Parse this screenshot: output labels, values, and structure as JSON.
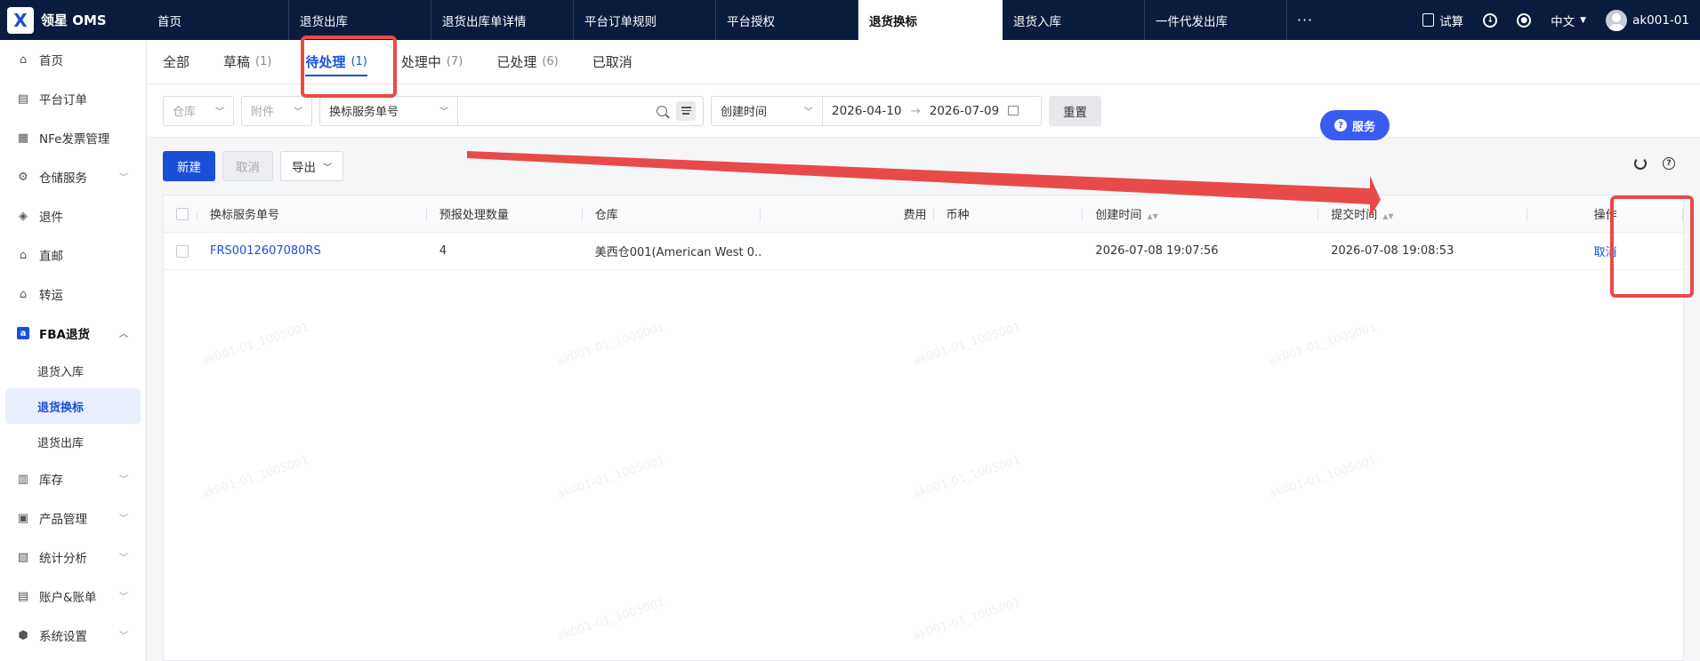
{
  "app": {
    "logo_text": "领星 OMS"
  },
  "topbar": {
    "tabs": [
      {
        "label": "首页"
      },
      {
        "label": "退货出库"
      },
      {
        "label": "退货出库单详情"
      },
      {
        "label": "平台订单规则"
      },
      {
        "label": "平台授权"
      },
      {
        "label": "退货换标",
        "active": true
      },
      {
        "label": "退货入库"
      },
      {
        "label": "一件代发出库"
      }
    ],
    "more": "···",
    "calc_label": "试算",
    "lang_label": "中文",
    "user_label": "ak001-01"
  },
  "sidebar": {
    "items": [
      {
        "label": "首页",
        "icon": "home-icon"
      },
      {
        "label": "平台订单",
        "icon": "clipboard-icon"
      },
      {
        "label": "NFe发票管理",
        "icon": "invoice-icon"
      },
      {
        "label": "仓储服务",
        "icon": "warehouse-service-icon"
      },
      {
        "label": "退件",
        "icon": "return-icon"
      },
      {
        "label": "直邮",
        "icon": "direct-mail-icon"
      },
      {
        "label": "转运",
        "icon": "transfer-icon"
      },
      {
        "label": "FBA退货",
        "icon": "fba-icon"
      },
      {
        "label": "库存",
        "icon": "inventory-icon"
      },
      {
        "label": "产品管理",
        "icon": "product-icon"
      },
      {
        "label": "统计分析",
        "icon": "stats-icon"
      },
      {
        "label": "账户&账单",
        "icon": "account-icon"
      },
      {
        "label": "系统设置",
        "icon": "settings-icon"
      }
    ],
    "fba_sub": [
      "退货入库",
      "退货换标",
      "退货出库"
    ]
  },
  "subtabs": [
    {
      "label": "全部",
      "count": ""
    },
    {
      "label": "草稿",
      "count": "(1)"
    },
    {
      "label": "待处理",
      "count": "(1)",
      "active": true
    },
    {
      "label": "处理中",
      "count": "(7)"
    },
    {
      "label": "已处理",
      "count": "(6)"
    },
    {
      "label": "已取消",
      "count": ""
    }
  ],
  "filters": {
    "warehouse_placeholder": "仓库",
    "attachment_placeholder": "附件",
    "search_field": "换标服务单号",
    "time_field": "创建时间",
    "date_start": "2026-04-10",
    "date_end": "2026-07-09",
    "reset_label": "重置"
  },
  "toolbar": {
    "new_label": "新建",
    "cancel_label": "取消",
    "export_label": "导出"
  },
  "service_label": "服务",
  "table": {
    "headers": {
      "id": "换标服务单号",
      "qty": "预报处理数量",
      "warehouse": "仓库",
      "fee": "费用",
      "currency": "币种",
      "created": "创建时间",
      "submitted": "提交时间",
      "action": "操作"
    },
    "rows": [
      {
        "id": "FRS0012607080RS",
        "qty": "4",
        "warehouse": "美西仓001(American West 0...",
        "fee": "",
        "currency": "",
        "created": "2026-07-08 19:07:56",
        "submitted": "2026-07-08 19:08:53",
        "action": "取消"
      }
    ]
  },
  "watermark_text": "ak001-01_1005001",
  "colors": {
    "topbar": "#0a1b3d",
    "accent": "#1a4fd8",
    "annotation": "#e84a4a"
  }
}
